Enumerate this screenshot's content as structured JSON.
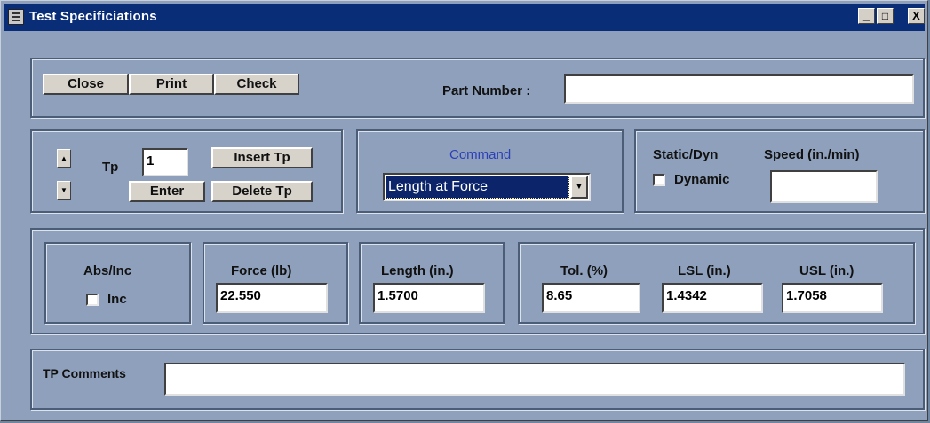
{
  "window": {
    "title": "Test Specificiations",
    "controls": {
      "minimize": "_",
      "maximize": "□",
      "close": "X"
    }
  },
  "toolbar": {
    "close_label": "Close",
    "print_label": "Print",
    "check_label": "Check",
    "part_number_label": "Part Number :",
    "part_number_value": ""
  },
  "tp": {
    "label": "Tp",
    "value": "1",
    "insert_label": "Insert Tp",
    "enter_label": "Enter",
    "delete_label": "Delete Tp",
    "up_glyph": "▲",
    "down_glyph": "▼"
  },
  "command": {
    "label": "Command",
    "selected": "Length at Force",
    "label_color": "#2c3fb8",
    "dropdown_glyph": "▼"
  },
  "static_dyn": {
    "label": "Static/Dyn",
    "checkbox_label": "Dynamic",
    "checked": false,
    "speed_label": "Speed (in./min)",
    "speed_value": ""
  },
  "params": {
    "abs_inc_label": "Abs/Inc",
    "inc_label": "Inc",
    "inc_checked": false,
    "force_label": "Force (lb)",
    "force_value": "22.550",
    "length_label": "Length (in.)",
    "length_value": "1.5700",
    "tol_label": "Tol. (%)",
    "tol_value": "8.65",
    "lsl_label": "LSL (in.)",
    "lsl_value": "1.4342",
    "usl_label": "USL (in.)",
    "usl_value": "1.7058"
  },
  "comments": {
    "label": "TP Comments",
    "value": ""
  }
}
